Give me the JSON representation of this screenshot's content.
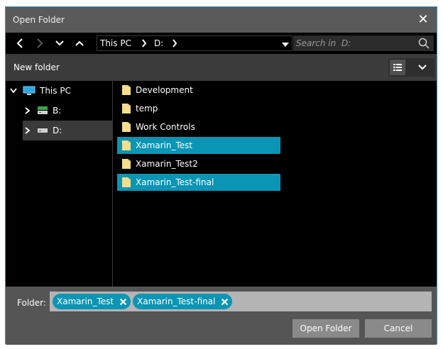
{
  "window": {
    "title": "Open Folder"
  },
  "nav": {
    "crumbs": [
      "This PC",
      "D:"
    ],
    "search_placeholder": "Search in  D:"
  },
  "toolbar": {
    "new_folder": "New folder"
  },
  "tree": {
    "root": "This PC",
    "drives": [
      {
        "label": "B:"
      },
      {
        "label": "D:",
        "selected": true
      }
    ]
  },
  "files": [
    {
      "name": "Development",
      "selected": false
    },
    {
      "name": "temp",
      "selected": false
    },
    {
      "name": "Work Controls",
      "selected": false
    },
    {
      "name": "Xamarin_Test",
      "selected": true
    },
    {
      "name": "Xamarin_Test2",
      "selected": false
    },
    {
      "name": "Xamarin_Test-final",
      "selected": true
    }
  ],
  "footer": {
    "folder_label": "Folder:",
    "chips": [
      "Xamarin_Test",
      "Xamarin_Test-final"
    ],
    "open_button": "Open Folder",
    "cancel_button": "Cancel"
  },
  "colors": {
    "accent": "#0a95b5",
    "folder": "#f5de8c",
    "window": "#555555"
  }
}
